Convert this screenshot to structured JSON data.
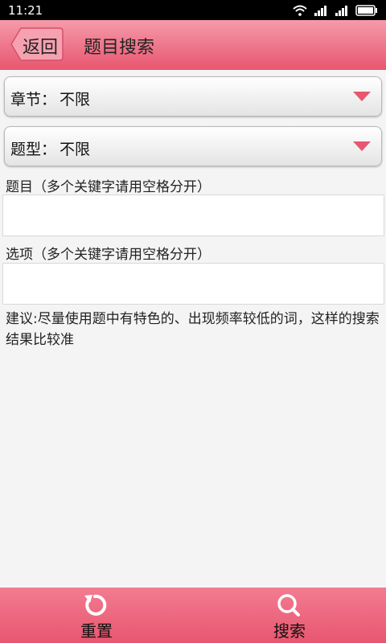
{
  "status_bar": {
    "time": "11:21"
  },
  "header": {
    "back_label": "返回",
    "title": "题目搜索"
  },
  "filters": {
    "chapter": {
      "label": "章节：",
      "value": "不限"
    },
    "type": {
      "label": "题型：",
      "value": "不限"
    }
  },
  "fields": {
    "question": {
      "label": "题目（多个关键字请用空格分开）",
      "value": ""
    },
    "option": {
      "label": "选项（多个关键字请用空格分开）",
      "value": ""
    }
  },
  "tip": "建议:尽量使用题中有特色的、出现频率较低的词，这样的搜索结果比较准",
  "bottom": {
    "reset_label": "重置",
    "search_label": "搜索"
  },
  "colors": {
    "accent": "#e8566f",
    "arrow": "#e8566f"
  }
}
